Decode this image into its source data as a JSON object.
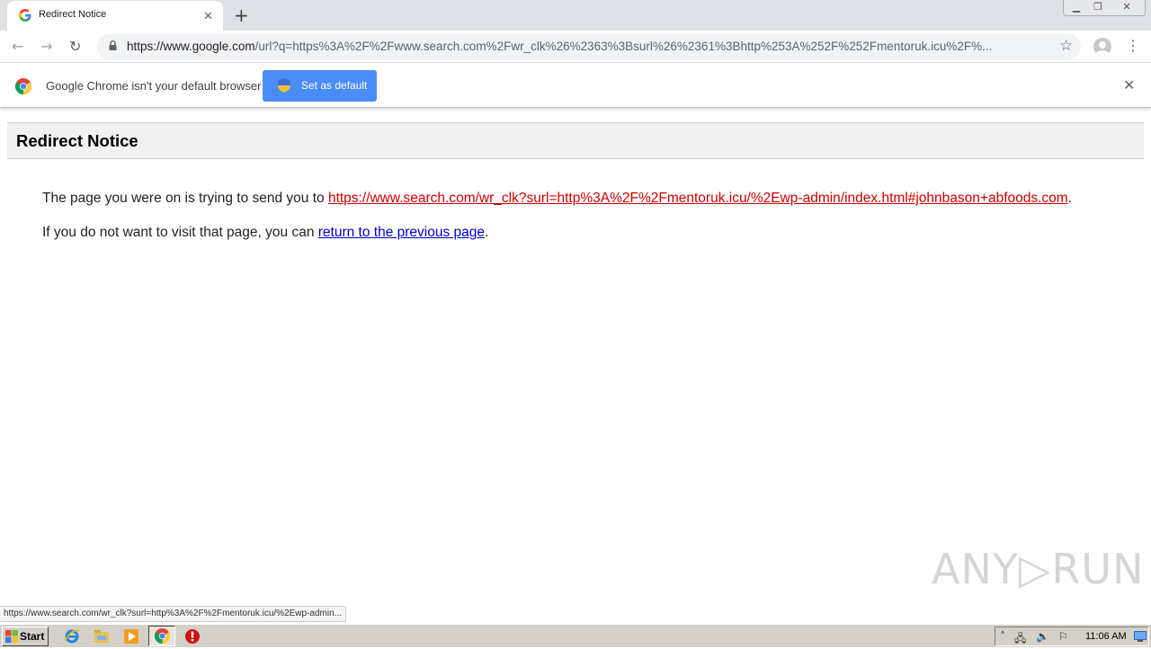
{
  "browser": {
    "tab_title": "Redirect Notice",
    "tab_close": "✕",
    "new_tab": "+",
    "url_host": "https://www.google.com",
    "url_path": "/url?q=https%3A%2F%2Fwww.search.com%2Fwr_clk%26%2363%3Bsurl%26%2361%3Bhttp%253A%252F%252Fmentoruk.icu%2F%...",
    "back": "←",
    "forward": "→",
    "reload": "↻",
    "star": "☆",
    "menu": "⋮"
  },
  "infobar": {
    "message": "Google Chrome isn't your default browser",
    "button_label": "Set as default",
    "close": "✕"
  },
  "page": {
    "title": "Redirect Notice",
    "line1_prefix": "The page you were on is trying to send you to ",
    "redirect_url": "https://www.search.com/wr_clk?surl=http%3A%2F%2Fmentoruk.icu/%2Ewp-admin/index.html#johnbason+abfoods.com",
    "line1_suffix": ".",
    "line2_prefix": "If you do not want to visit that page, you can ",
    "back_link": "return to the previous page",
    "line2_suffix": "."
  },
  "status_bubble": "https://www.search.com/wr_clk?surl=http%3A%2F%2Fmentoruk.icu/%2Ewp-admin...",
  "watermark": "ANY▷RUN",
  "taskbar": {
    "start_label": "Start",
    "clock": "11:06 AM"
  },
  "colors": {
    "link_red": "#cc0000",
    "link_blue": "#0000cc",
    "button_blue": "#4b8df8"
  }
}
